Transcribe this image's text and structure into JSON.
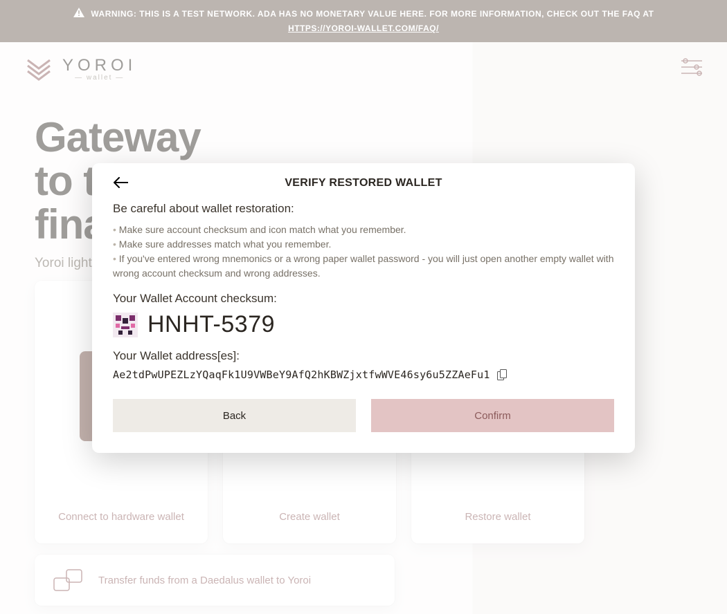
{
  "banner": {
    "text": "WARNING: THIS IS A TEST NETWORK. ADA HAS NO MONETARY VALUE HERE. FOR MORE INFORMATION, CHECK OUT THE FAQ AT",
    "link": "HTTPS://YOROI-WALLET.COM/FAQ/"
  },
  "logo": {
    "main": "YOROI",
    "sub": "— wallet —"
  },
  "hero": {
    "line1": "Gateway",
    "line2": "to the",
    "line3": "financial",
    "subtitle": "Yoroi light wallet for Cardano"
  },
  "cards": [
    {
      "label": "Connect to hardware wallet"
    },
    {
      "label": "Create wallet"
    },
    {
      "label": "Restore wallet"
    }
  ],
  "transfer": {
    "label": "Transfer funds from a Daedalus wallet to Yoroi"
  },
  "modal": {
    "title": "VERIFY RESTORED WALLET",
    "care_heading": "Be careful about wallet restoration:",
    "bullets": [
      "Make sure account checksum and icon match what you remember.",
      "Make sure addresses match what you remember.",
      "If you've entered wrong mnemonics or a wrong paper wallet password - you will just open another empty wallet with wrong account checksum and wrong addresses."
    ],
    "checksum_label": "Your Wallet Account checksum:",
    "checksum_value": "HNHT-5379",
    "addr_label": "Your Wallet address[es]:",
    "addr_value": "Ae2tdPwUPEZLzYQaqFk1U9VWBeY9AfQ2hKBWZjxtfwWVE46sy6u5ZZAeFu1",
    "back": "Back",
    "confirm": "Confirm"
  },
  "colors": {
    "accent": "#8B5A5A",
    "accent_lighter": "#E3C4C4",
    "banner_bg": "#6B5B50"
  }
}
